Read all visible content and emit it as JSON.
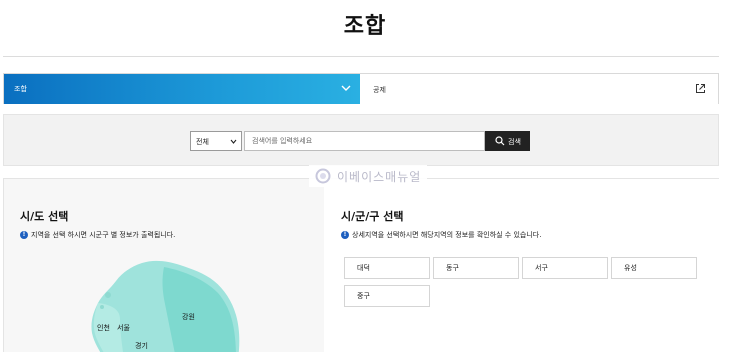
{
  "page": {
    "title": "조합"
  },
  "tabs": [
    {
      "label": "조합",
      "active": true
    },
    {
      "label": "공제",
      "active": false
    }
  ],
  "search": {
    "scope_selected": "전체",
    "placeholder": "검색어를 입력하세요",
    "button_label": "검색"
  },
  "watermark": {
    "text": "이베이스매뉴얼"
  },
  "sido": {
    "heading": "시/도 선택",
    "info": "지역을 선택 하시면 시군구 별 정보가 출력됩니다.",
    "regions": [
      "인천",
      "서울",
      "강원",
      "경기"
    ]
  },
  "sigungu": {
    "heading": "시/군/구 선택",
    "info": "상세지역을 선택하시면 해당지역의 정보를 확인하실 수 있습니다.",
    "districts": [
      "대덕",
      "동구",
      "서구",
      "유성",
      "중구"
    ]
  },
  "colors": {
    "tab_active_start": "#0a6fc0",
    "tab_active_end": "#2ab0e2",
    "search_button": "#222222",
    "info_icon": "#1d5fbf",
    "map_fill": "#9fe3dc"
  }
}
